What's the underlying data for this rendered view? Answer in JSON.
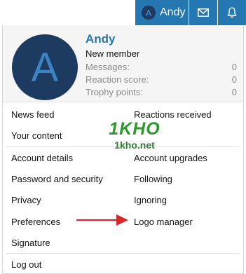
{
  "navbar": {
    "avatar_letter": "A",
    "username": "Andy",
    "icons": [
      "envelope-icon",
      "bell-icon"
    ],
    "accent_color": "#2577b1"
  },
  "profile": {
    "avatar_letter": "A",
    "name": "Andy",
    "title": "New member",
    "stats": [
      {
        "label": "Messages:",
        "value": "0"
      },
      {
        "label": "Reaction score:",
        "value": "0"
      },
      {
        "label": "Trophy points:",
        "value": "0"
      }
    ]
  },
  "menu": {
    "news_feed": "News feed",
    "reactions_received": "Reactions received",
    "your_content": "Your content",
    "account_details": "Account details",
    "account_upgrades": "Account upgrades",
    "password_security": "Password and security",
    "following": "Following",
    "privacy": "Privacy",
    "ignoring": "Ignoring",
    "preferences": "Preferences",
    "logo_manager": "Logo manager",
    "signature": "Signature",
    "log_out": "Log out"
  },
  "watermark": {
    "brand": "1KHO",
    "site": "1kho.net"
  },
  "annotation": {
    "arrow_color": "#d9262b"
  }
}
